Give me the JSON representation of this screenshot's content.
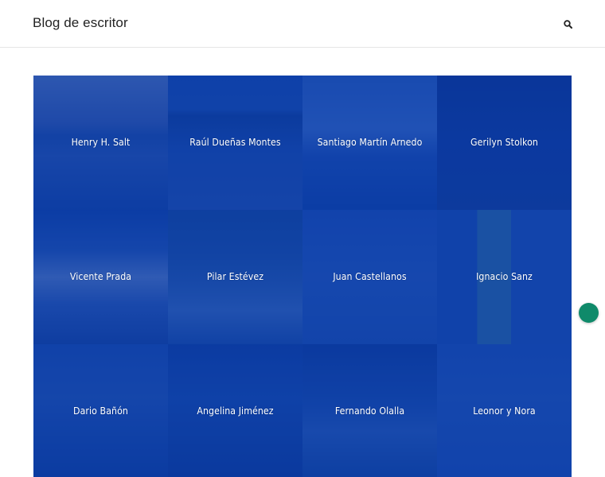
{
  "header": {
    "site_title": "Blog de escritor",
    "search_icon": "search-icon"
  },
  "grid": {
    "tiles": [
      {
        "name": "Henry H. Salt"
      },
      {
        "name": "Raúl Dueñas Montes"
      },
      {
        "name": "Santiago Martín Arnedo"
      },
      {
        "name": "Gerilyn Stolkon"
      },
      {
        "name": "Vicente Prada"
      },
      {
        "name": "Pilar Estévez"
      },
      {
        "name": "Juan Castellanos"
      },
      {
        "name": "Ignacio Sanz"
      },
      {
        "name": "Dario Bañón"
      },
      {
        "name": "Angelina Jiménez"
      },
      {
        "name": "Fernando Olalla"
      },
      {
        "name": "Leonor y Nora"
      }
    ],
    "overlay_color": "#0a3caa"
  },
  "fab": {
    "color": "#0f8a6a"
  }
}
